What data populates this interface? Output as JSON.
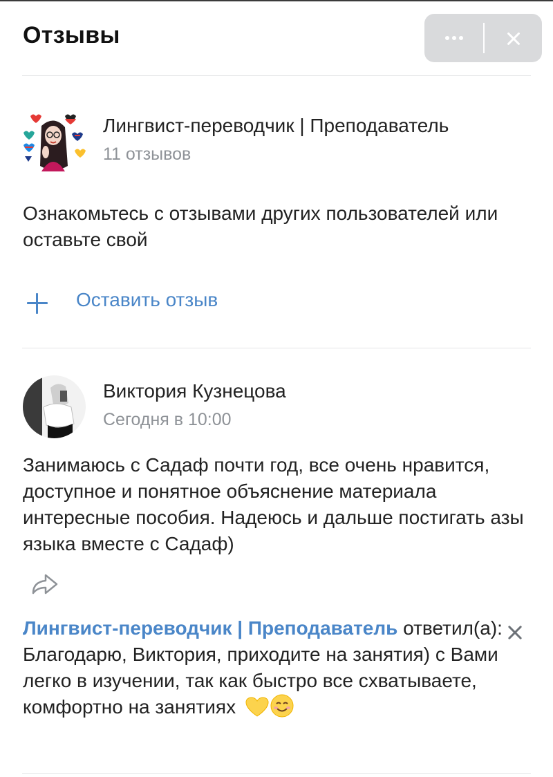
{
  "header": {
    "title": "Отзывы",
    "more_icon": "more-horizontal-icon",
    "close_icon": "close-icon",
    "actions_bg": "#d9dadc"
  },
  "community": {
    "name": "Лингвист-переводчик | Преподаватель",
    "reviews_count": "11 отзывов",
    "avatar_icon": "community-avatar"
  },
  "intro": {
    "text": "Ознакомьтесь с отзывами других пользователей или оставьте свой"
  },
  "actions": {
    "leave_review_label": "Оставить отзыв",
    "leave_review_icon": "plus-icon",
    "accent_color": "#4a86c8"
  },
  "review": {
    "author": "Виктория Кузнецова",
    "date": "Сегодня в 10:00",
    "text": "Занимаюсь с Садаф почти год, все очень нравится, доступное и понятное объяснение материала интересные пособия. Надеюсь и дальше постигать азы языка вместе с Садаф)",
    "share_icon": "share-icon",
    "reply": {
      "author": "Лингвист-переводчик | Преподаватель",
      "text": " ответил(а): Благодарю, Виктория, приходите на занятия) с Вами легко в изучении, так как быстро все схватываете, комфортно на занятиях",
      "emojis": [
        "yellow-heart-emoji",
        "smiling-face-emoji"
      ],
      "close_icon": "close-icon"
    }
  }
}
